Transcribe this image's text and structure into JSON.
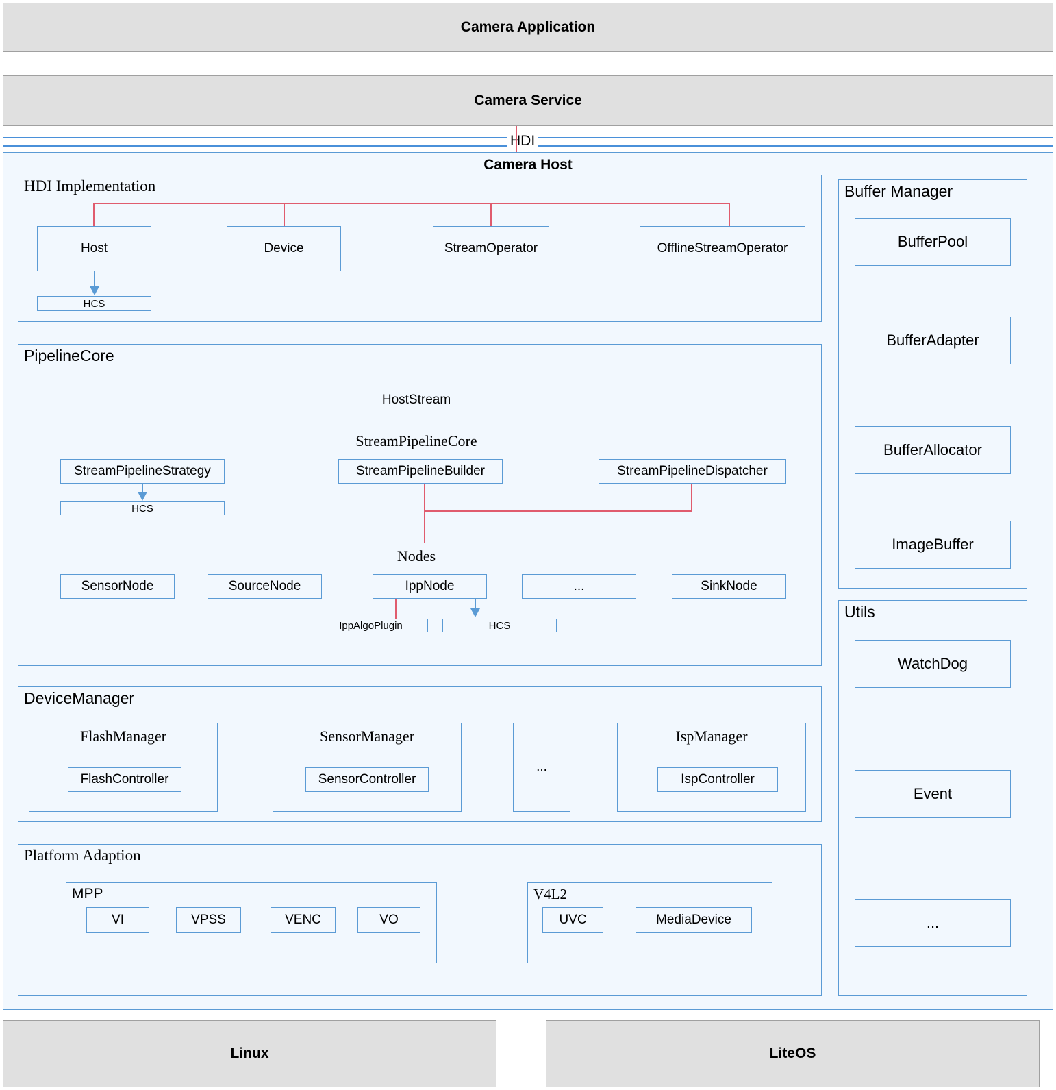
{
  "layers": {
    "application": {
      "label": "Camera Application"
    },
    "service": {
      "label": "Camera Service"
    },
    "hdi_divider": {
      "label": "HDI"
    },
    "camera_host": {
      "label": "Camera Host"
    },
    "linux": {
      "label": "Linux"
    },
    "liteos": {
      "label": "LiteOS"
    }
  },
  "hdi_implementation": {
    "title": "HDI Implementation",
    "nodes": [
      {
        "label": "Host"
      },
      {
        "label": "Device"
      },
      {
        "label": "StreamOperator"
      },
      {
        "label": "OfflineStreamOperator"
      }
    ],
    "host_config": {
      "label": "HCS"
    }
  },
  "pipeline_core": {
    "title": "PipelineCore",
    "host_stream": {
      "label": "HostStream"
    },
    "stream_pipeline_core": {
      "title": "StreamPipelineCore",
      "nodes": [
        {
          "label": "StreamPipelineStrategy"
        },
        {
          "label": "StreamPipelineBuilder"
        },
        {
          "label": "StreamPipelineDispatcher"
        }
      ],
      "strategy_config": {
        "label": "HCS"
      }
    },
    "nodes_group": {
      "title": "Nodes",
      "nodes": [
        {
          "label": "SensorNode"
        },
        {
          "label": "SourceNode"
        },
        {
          "label": "IppNode"
        },
        {
          "label": "..."
        },
        {
          "label": "SinkNode"
        }
      ],
      "ipp_algo_plugin": {
        "label": "IppAlgoPlugin"
      },
      "ipp_config": {
        "label": "HCS"
      }
    }
  },
  "device_manager": {
    "title": "DeviceManager",
    "managers": [
      {
        "label": "FlashManager",
        "controller": "FlashController"
      },
      {
        "label": "SensorManager",
        "controller": "SensorController"
      },
      {
        "label": "...",
        "controller": ""
      },
      {
        "label": "IspManager",
        "controller": "IspController"
      }
    ]
  },
  "platform_adaption": {
    "title": "Platform Adaption",
    "groups": [
      {
        "title": "MPP",
        "items": [
          "VI",
          "VPSS",
          "VENC",
          "VO"
        ]
      },
      {
        "title": "V4L2",
        "items": [
          "UVC",
          "MediaDevice"
        ]
      }
    ]
  },
  "buffer_manager": {
    "title": "Buffer Manager",
    "items": [
      {
        "label": "BufferPool"
      },
      {
        "label": "BufferAdapter"
      },
      {
        "label": "BufferAllocator"
      },
      {
        "label": "ImageBuffer"
      }
    ]
  },
  "utils": {
    "title": "Utils",
    "items": [
      {
        "label": "WatchDog"
      },
      {
        "label": "Event"
      },
      {
        "label": "..."
      }
    ]
  },
  "colors": {
    "gray_fill": "#e0e0e0",
    "gray_border": "#a0a0a0",
    "blue_fill": "#f2f8fe",
    "blue_border": "#5b9bd5",
    "red_connector": "#e05c6e",
    "text": "#000000"
  }
}
